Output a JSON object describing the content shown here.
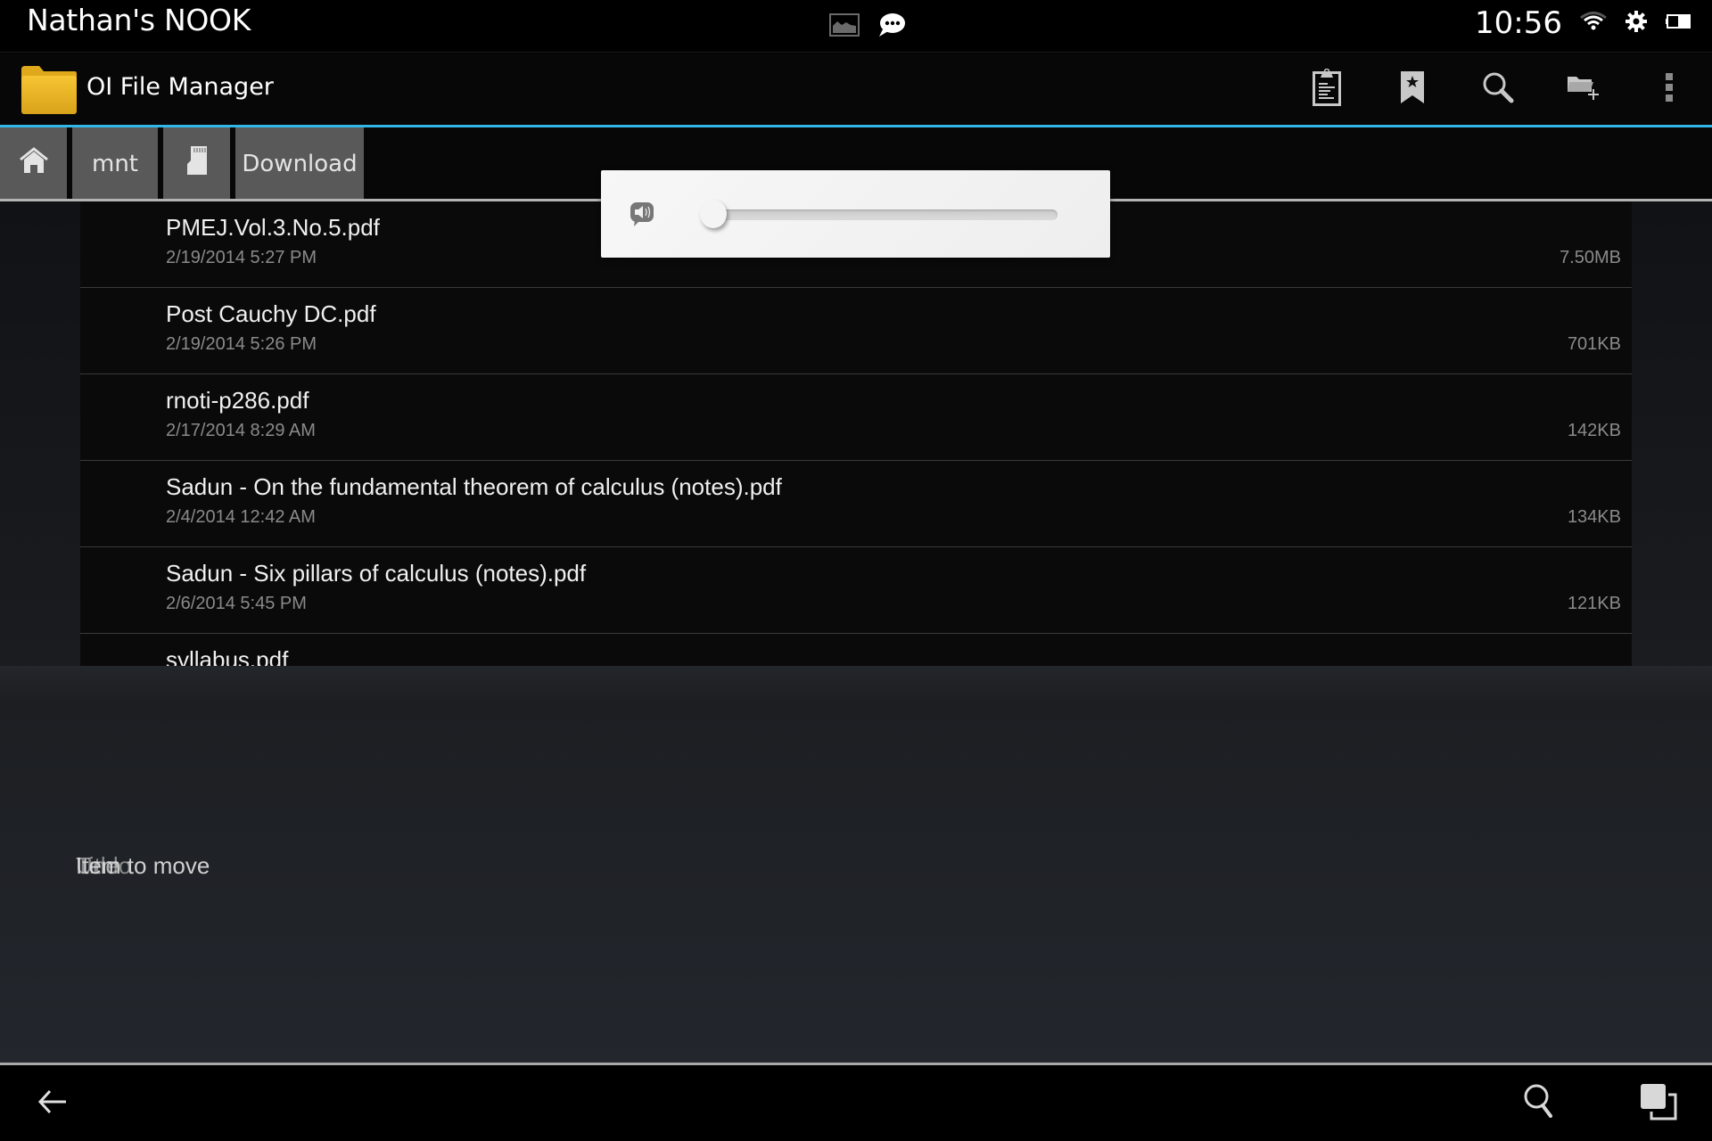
{
  "status_bar": {
    "device_name": "Nathan's NOOK",
    "time": "10:56",
    "notifications": [
      "image-icon",
      "chat-bubble-icon"
    ],
    "indicators": [
      "wifi-icon",
      "settings-gear-icon",
      "battery-icon"
    ]
  },
  "action_bar": {
    "app_title": "OI File Manager",
    "app_icon": "folder-icon",
    "actions": [
      {
        "name": "paste-clipboard",
        "icon": "clipboard-icon"
      },
      {
        "name": "bookmarks",
        "icon": "bookmark-star-icon"
      },
      {
        "name": "search",
        "icon": "search-icon"
      },
      {
        "name": "create-folder",
        "icon": "new-folder-icon"
      },
      {
        "name": "overflow-menu",
        "icon": "more-vertical-icon"
      }
    ],
    "accent_color": "#33b5e5"
  },
  "breadcrumb": [
    {
      "label": "",
      "icon": "home-icon"
    },
    {
      "label": "mnt"
    },
    {
      "label": "",
      "icon": "sd-card-icon"
    },
    {
      "label": "Download"
    }
  ],
  "files": [
    {
      "name": "PMEJ.Vol.3.No.5.pdf",
      "date": "2/19/2014 5:27 PM",
      "size": "7.50MB"
    },
    {
      "name": "Post Cauchy DC.pdf",
      "date": "2/19/2014 5:26 PM",
      "size": "701KB"
    },
    {
      "name": "rnoti-p286.pdf",
      "date": "2/17/2014 8:29 AM",
      "size": "142KB"
    },
    {
      "name": "Sadun - On the fundamental theorem of calculus (notes).pdf",
      "date": "2/4/2014 12:42 AM",
      "size": "134KB"
    },
    {
      "name": "Sadun - Six pillars of calculus (notes).pdf",
      "date": "2/6/2014 5:45 PM",
      "size": "121KB"
    },
    {
      "name": "syllabus.pdf",
      "date": "",
      "size": ""
    }
  ],
  "volume_dialog": {
    "icon": "speaker-volume-icon",
    "level": 0
  },
  "bottom_panel": {
    "hint_texts": [
      "Item to move",
      "Undo",
      "Title"
    ]
  },
  "nav_bar": {
    "buttons": [
      "back",
      "search",
      "recent-apps"
    ]
  }
}
